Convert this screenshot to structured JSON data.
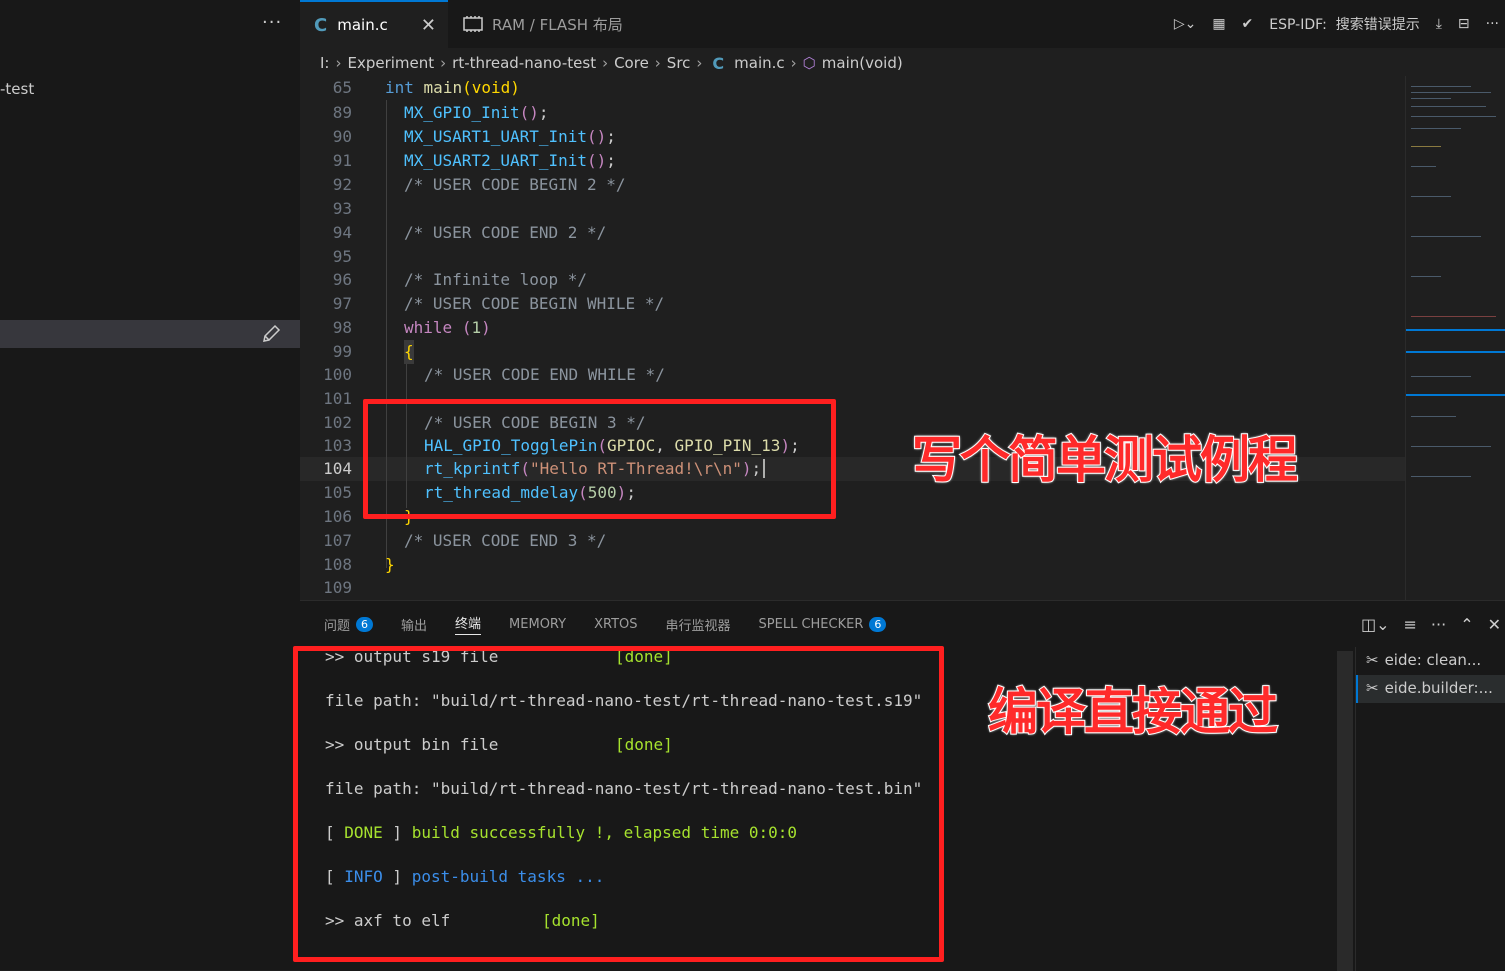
{
  "sidebar": {
    "more_label": "···",
    "project_label": "-test"
  },
  "tabs": [
    {
      "icon": "c-file-icon",
      "icon_text": "C",
      "label": "main.c",
      "close": "✕"
    },
    {
      "icon": "memory-chip-icon",
      "label": "RAM / FLASH 布局"
    }
  ],
  "toolbar": {
    "esp_label": "ESP-IDF:",
    "search_label": "搜索错误提示",
    "more": "···"
  },
  "breadcrumb": [
    "I:",
    "Experiment",
    "rt-thread-nano-test",
    "Core",
    "Src",
    "main.c",
    "main(void)"
  ],
  "breadcrumb_c_icon": "C",
  "editor": {
    "line_numbers": [
      "65",
      "89",
      "90",
      "91",
      "92",
      "93",
      "94",
      "95",
      "96",
      "97",
      "98",
      "99",
      "100",
      "101",
      "102",
      "103",
      "104",
      "105",
      "106",
      "107",
      "108",
      "109"
    ],
    "active_line": "104",
    "sticky": {
      "kw": "int",
      "fn": "main",
      "args": "(void)"
    },
    "code": {
      "l89": "MX_GPIO_Init",
      "l90": "MX_USART1_UART_Init",
      "l91": "MX_USART2_UART_Init",
      "l92": "/* USER CODE BEGIN 2 */",
      "l94": "/* USER CODE END 2 */",
      "l96": "/* Infinite loop */",
      "l97": "/* USER CODE BEGIN WHILE */",
      "l98_kw": "while",
      "l98_num": "1",
      "l99": "{",
      "l100": "/* USER CODE END WHILE */",
      "l102": "/* USER CODE BEGIN 3 */",
      "l103_fn": "HAL_GPIO_TogglePin",
      "l103_a1": "GPIOC",
      "l103_a2": "GPIO_PIN_13",
      "l104_fn": "rt_kprintf",
      "l104_str": "\"Hello RT-Thread!\\r\\n\"",
      "l105_fn": "rt_thread_mdelay",
      "l105_num": "500",
      "l106": "}",
      "l107": "/* USER CODE END 3 */",
      "l108": "}"
    }
  },
  "annotations": {
    "editor_note": "写个简单测试例程",
    "terminal_note": "编译直接通过"
  },
  "panel": {
    "tabs": [
      {
        "label": "问题",
        "badge": "6"
      },
      {
        "label": "输出"
      },
      {
        "label": "终端",
        "active": true
      },
      {
        "label": "MEMORY"
      },
      {
        "label": "XRTOS"
      },
      {
        "label": "串行监视器"
      },
      {
        "label": "SPELL CHECKER",
        "badge": "6"
      }
    ],
    "terminal_lines": {
      "t1a": ">> output s19 file",
      "t1b": "[done]",
      "t2": "file path: \"build/rt-thread-nano-test/rt-thread-nano-test.s19\"",
      "t3a": ">> output bin file",
      "t3b": "[done]",
      "t4": "file path: \"build/rt-thread-nano-test/rt-thread-nano-test.bin\"",
      "t5a": "[ ",
      "t5b": "DONE",
      "t5c": " ] ",
      "t5d": "build successfully !, elapsed time 0:0:0",
      "t6a": "[ ",
      "t6b": "INFO",
      "t6c": " ] ",
      "t6d": "post-build tasks ...",
      "t7a": ">> axf to elf",
      "t7b": "[done]"
    },
    "terminal_list": [
      "eide: clean...",
      "eide.builder:..."
    ]
  },
  "colors": {
    "accent": "#0078d4",
    "annotation_red": "#ff1f1f"
  }
}
